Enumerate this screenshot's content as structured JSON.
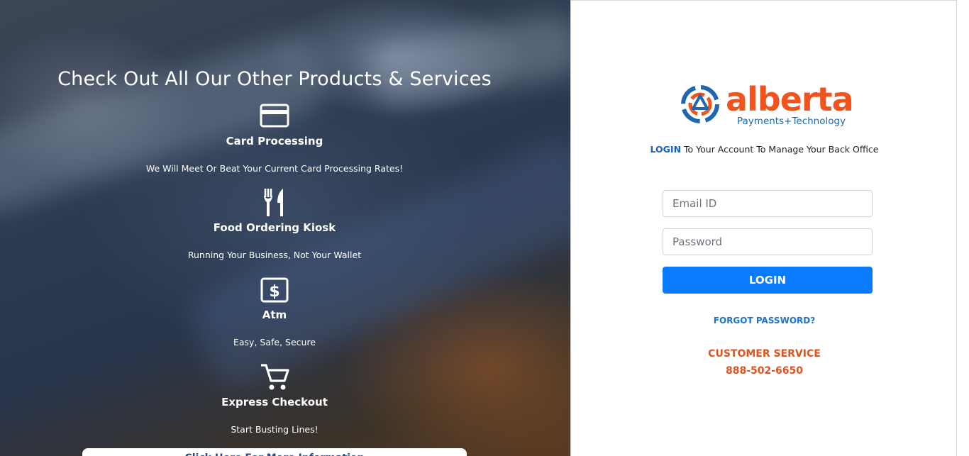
{
  "promo": {
    "heading": "Check Out All Our Other Products & Services",
    "products": [
      {
        "icon": "credit-card-icon",
        "name": "Card Processing",
        "description": "We Will Meet Or Beat Your Current Card Processing Rates!"
      },
      {
        "icon": "utensils-icon",
        "name": "Food Ordering Kiosk",
        "description": "Running Your Business, Not Your Wallet"
      },
      {
        "icon": "money-bill-icon",
        "name": "Atm",
        "description": "Easy, Safe, Secure"
      },
      {
        "icon": "shopping-cart-icon",
        "name": "Express Checkout",
        "description": "Start Busting Lines!"
      }
    ],
    "more_info_label": "Click Here For More Information"
  },
  "brand": {
    "name": "alberta",
    "tagline": "Payments+Technology",
    "logo_color": "#f0531c",
    "tagline_color": "#2166b0"
  },
  "login": {
    "intro_accent": "LOGIN",
    "intro_rest": " To Your Account To Manage Your Back Office",
    "email_placeholder": "Email ID",
    "password_placeholder": "Password",
    "button_label": "LOGIN",
    "forgot_label": "FORGOT PASSWORD?",
    "button_color": "#0a7bff"
  },
  "support": {
    "title": "CUSTOMER SERVICE",
    "phone": "888-502-6650",
    "color": "#e0531e"
  }
}
